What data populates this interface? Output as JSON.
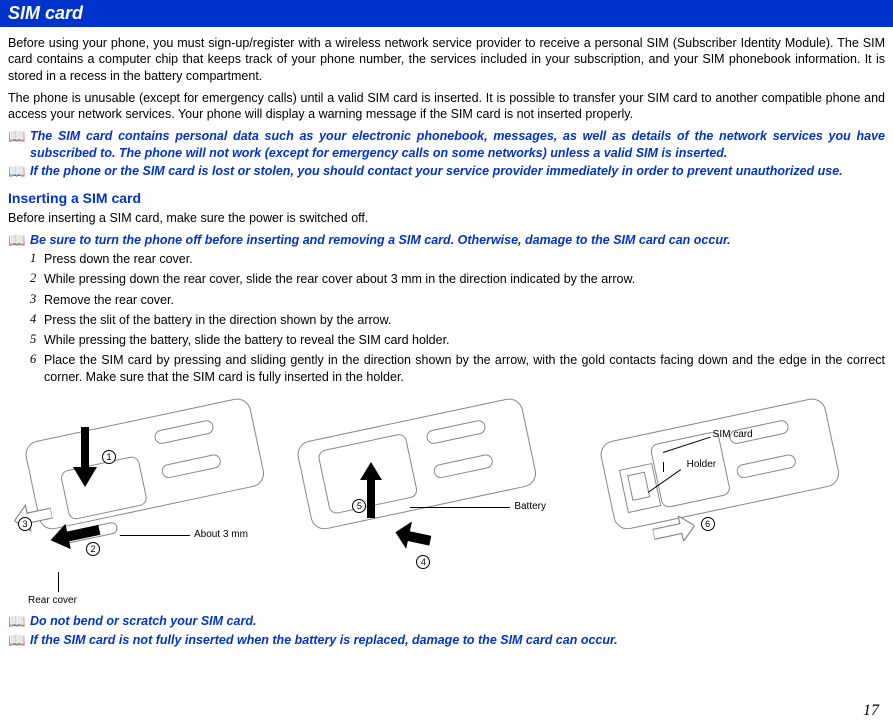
{
  "header": {
    "title": "SIM card"
  },
  "intro": {
    "p1": "Before using your phone, you must sign-up/register with a wireless network service provider to receive a personal SIM (Subscriber Identity Module). The SIM card contains a computer chip that keeps track of your phone number, the services included in your subscription, and your SIM phonebook information. It is stored in a recess in the battery compartment.",
    "p2": "The phone is unusable (except for emergency calls) until a valid SIM card is inserted. It is possible to transfer your SIM card to another compatible phone and access your network services. Your phone will display a warning message if the SIM card is not inserted properly."
  },
  "notes_top": [
    "The SIM card contains personal data such as your electronic phonebook, messages, as well as details of the network services you have subscribed to. The phone will not work (except for emergency calls on some networks) unless a valid SIM is inserted.",
    "If the phone or the SIM card is lost or stolen, you should contact your service provider immediately in order to prevent unauthorized use."
  ],
  "section": {
    "heading": "Inserting a SIM card",
    "lead": "Before inserting a SIM card, make sure the power is switched off.",
    "warning": "Be sure to turn the phone off before inserting and removing a SIM card. Otherwise, damage to the SIM card can occur.",
    "steps": [
      "Press down the rear cover.",
      "While pressing down the rear cover, slide the rear cover about 3 mm in the direction indicated by the arrow.",
      "Remove the rear cover.",
      "Press the slit of the battery in the direction shown by the arrow.",
      "While pressing the battery, slide the battery to reveal the SIM card holder.",
      "Place the SIM card by pressing and sliding gently in the direction shown by the arrow, with the gold contacts facing down and the edge in the correct corner. Make sure that the SIM card is fully inserted in the holder."
    ]
  },
  "diagram_labels": {
    "rear_cover": "Rear cover",
    "about_3mm": "About 3 mm",
    "battery": "Battery",
    "sim_card": "SIM card",
    "holder": "Holder",
    "n1": "1",
    "n2": "2",
    "n3": "3",
    "n4": "4",
    "n5": "5",
    "n6": "6"
  },
  "notes_bottom": [
    "Do not bend or scratch your SIM card.",
    "If the SIM card is not fully inserted when the battery is replaced, damage to the SIM card can occur."
  ],
  "page_number": "17"
}
